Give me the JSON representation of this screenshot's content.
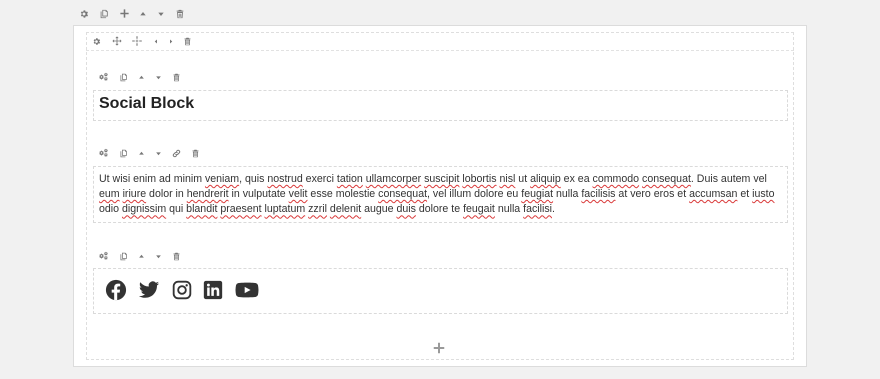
{
  "block": {
    "heading": "Social Block"
  },
  "paragraph": {
    "segments": [
      {
        "text": "Ut wisi enim ad minim ",
        "spell": false
      },
      {
        "text": "veniam",
        "spell": true
      },
      {
        "text": ", quis ",
        "spell": false
      },
      {
        "text": "nostrud",
        "spell": true
      },
      {
        "text": " exerci ",
        "spell": false
      },
      {
        "text": "tation",
        "spell": true
      },
      {
        "text": " ",
        "spell": false
      },
      {
        "text": "ullamcorper",
        "spell": true
      },
      {
        "text": " ",
        "spell": false
      },
      {
        "text": "suscipit",
        "spell": true
      },
      {
        "text": " ",
        "spell": false
      },
      {
        "text": "lobortis",
        "spell": true
      },
      {
        "text": " ",
        "spell": false
      },
      {
        "text": "nisl",
        "spell": true
      },
      {
        "text": " ut ",
        "spell": false
      },
      {
        "text": "aliquip",
        "spell": true
      },
      {
        "text": " ex ea ",
        "spell": false
      },
      {
        "text": "commodo",
        "spell": true
      },
      {
        "text": " ",
        "spell": false
      },
      {
        "text": "consequat",
        "spell": true
      },
      {
        "text": ". Duis autem vel ",
        "spell": false
      },
      {
        "text": "eum",
        "spell": true
      },
      {
        "text": " ",
        "spell": false
      },
      {
        "text": "iriure",
        "spell": true
      },
      {
        "text": " dolor in ",
        "spell": false
      },
      {
        "text": "hendrerit",
        "spell": true
      },
      {
        "text": " in vulputate ",
        "spell": false
      },
      {
        "text": "velit",
        "spell": true
      },
      {
        "text": " esse molestie ",
        "spell": false
      },
      {
        "text": "consequat",
        "spell": true
      },
      {
        "text": ", vel illum dolore eu ",
        "spell": false
      },
      {
        "text": "feugiat",
        "spell": true
      },
      {
        "text": " nulla ",
        "spell": false
      },
      {
        "text": "facilisis",
        "spell": true
      },
      {
        "text": " at vero eros et ",
        "spell": false
      },
      {
        "text": "accumsan",
        "spell": true
      },
      {
        "text": " et ",
        "spell": false
      },
      {
        "text": "iusto",
        "spell": true
      },
      {
        "text": " odio ",
        "spell": false
      },
      {
        "text": "dignissim",
        "spell": true
      },
      {
        "text": " qui ",
        "spell": false
      },
      {
        "text": "blandit",
        "spell": true
      },
      {
        "text": " ",
        "spell": false
      },
      {
        "text": "praesent",
        "spell": true
      },
      {
        "text": " ",
        "spell": false
      },
      {
        "text": "luptatum",
        "spell": true
      },
      {
        "text": " ",
        "spell": false
      },
      {
        "text": "zzril",
        "spell": true
      },
      {
        "text": " ",
        "spell": false
      },
      {
        "text": "delenit",
        "spell": true
      },
      {
        "text": " augue ",
        "spell": false
      },
      {
        "text": "duis",
        "spell": true
      },
      {
        "text": " dolore te ",
        "spell": false
      },
      {
        "text": "feugait",
        "spell": true
      },
      {
        "text": " nulla ",
        "spell": false
      },
      {
        "text": "facilisi",
        "spell": true
      },
      {
        "text": ".",
        "spell": false
      }
    ]
  },
  "social": {
    "icons": [
      "facebook-icon",
      "twitter-icon",
      "instagram-icon",
      "linkedin-icon",
      "youtube-icon"
    ]
  },
  "colors": {
    "background": "#f1f1f1",
    "toolbar_icon": "#777777",
    "spell_underline": "#d93838",
    "text": "#333333"
  }
}
